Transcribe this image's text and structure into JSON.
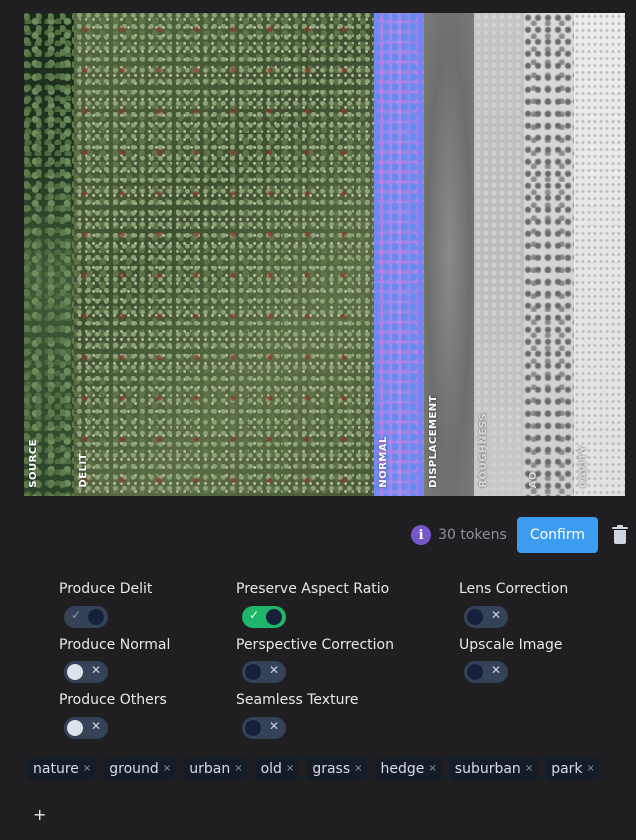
{
  "preview": {
    "strips": [
      {
        "label": "SOURCE"
      },
      {
        "label": "DELIT"
      },
      {
        "label": "NORMAL"
      },
      {
        "label": "DISPLACEMENT"
      },
      {
        "label": "ROUGHNESS"
      },
      {
        "label": "AO"
      },
      {
        "label": "CAVITY"
      }
    ]
  },
  "actions": {
    "info_icon": "i",
    "tokens": "30 tokens",
    "confirm_label": "Confirm"
  },
  "options": {
    "produce_delit": {
      "label": "Produce Delit",
      "on": true
    },
    "produce_normal": {
      "label": "Produce Normal",
      "on": false
    },
    "produce_others": {
      "label": "Produce Others",
      "on": false
    },
    "preserve_aspect_ratio": {
      "label": "Preserve Aspect Ratio",
      "on": true
    },
    "perspective_correction": {
      "label": "Perspective Correction",
      "on": false
    },
    "seamless_texture": {
      "label": "Seamless Texture",
      "on": false
    },
    "lens_correction": {
      "label": "Lens Correction",
      "on": false
    },
    "upscale_image": {
      "label": "Upscale Image",
      "on": false
    }
  },
  "toggle_marks": {
    "check": "✓",
    "cross": "✕"
  },
  "tags": [
    "nature",
    "ground",
    "urban",
    "old",
    "grass",
    "hedge",
    "suburban",
    "park"
  ],
  "tag_remove": "×",
  "add_tag": "+",
  "colors": {
    "background": "#1f1f21",
    "confirm": "#3c9df0",
    "toggle_on_green": "#1fb56a",
    "toggle_track": "#354257",
    "info": "#7457c9"
  }
}
